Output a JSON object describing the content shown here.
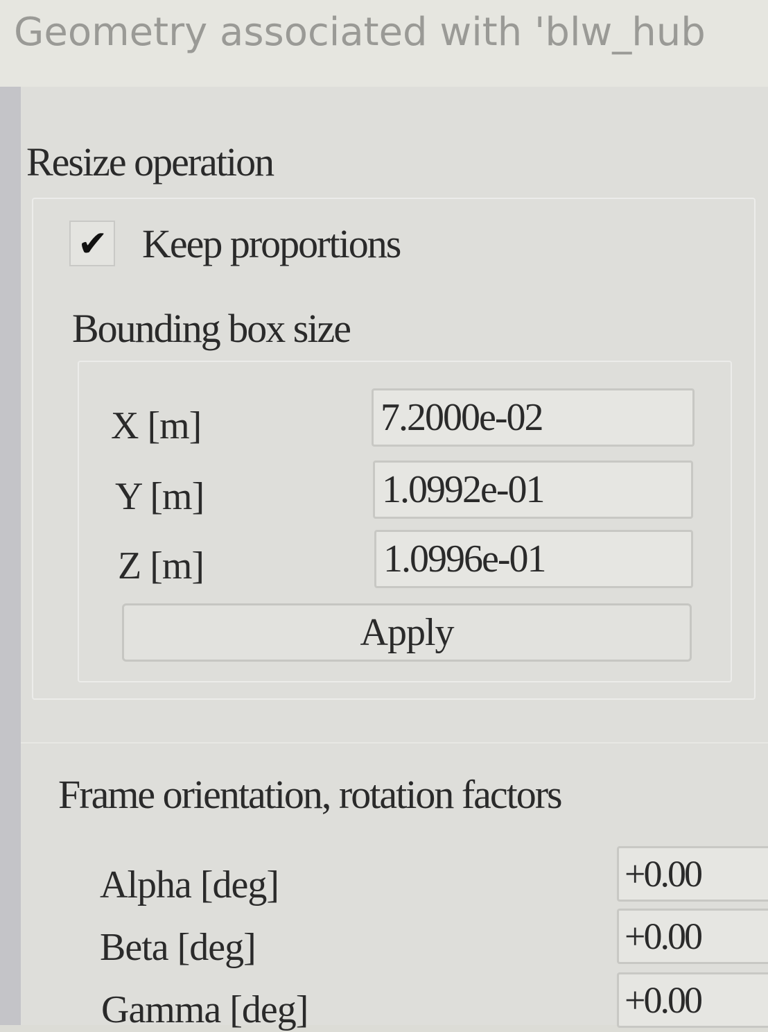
{
  "window": {
    "title": "Geometry associated with 'blw_hub"
  },
  "resize": {
    "heading": "Resize operation",
    "keep_proportions": {
      "label": "Keep proportions",
      "checked": true
    },
    "bounding_box": {
      "heading": "Bounding box size",
      "fields": [
        {
          "label": "X [m]",
          "value": "7.2000e-02"
        },
        {
          "label": "Y [m]",
          "value": "1.0992e-01"
        },
        {
          "label": "Z [m]",
          "value": "1.0996e-01"
        }
      ]
    },
    "apply_label": "Apply"
  },
  "rotation": {
    "heading": "Frame orientation, rotation factors",
    "fields": [
      {
        "label": "Alpha [deg]",
        "value": "+0.00"
      },
      {
        "label": "Beta [deg]",
        "value": "+0.00"
      },
      {
        "label": "Gamma [deg]",
        "value": "+0.00"
      }
    ]
  }
}
